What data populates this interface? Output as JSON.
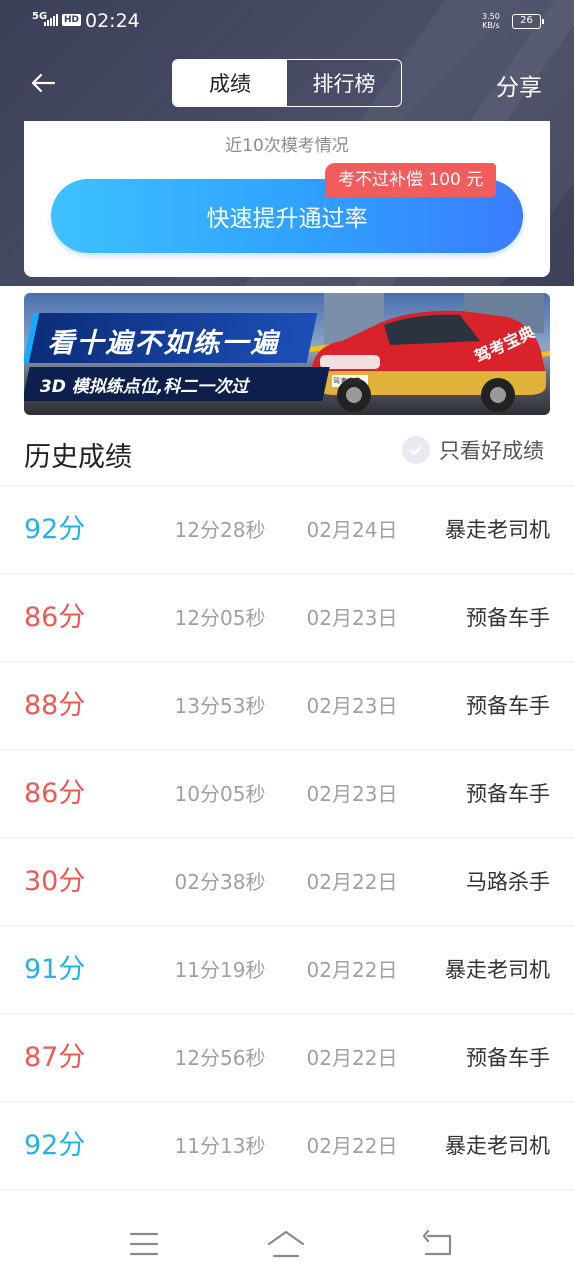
{
  "status_bar": {
    "network": "5G",
    "hd": "HD",
    "time": "02:24",
    "speed_value": "3.50",
    "speed_unit": "KB/s",
    "battery": "26"
  },
  "nav": {
    "back_icon": "arrow-left-icon",
    "tabs": [
      {
        "label": "成绩",
        "active": true
      },
      {
        "label": "排行榜",
        "active": false
      }
    ],
    "share_label": "分享"
  },
  "summary_card": {
    "subtitle": "近10次模考情况",
    "button_label": "快速提升通过率",
    "badge": "考不过补偿 100 元"
  },
  "banner": {
    "headline": "看十遍不如练一遍",
    "subline": "3D 模拟练点位,科二一次过",
    "car_text": "驾考宝典",
    "plate_text": "驾考宝典"
  },
  "history": {
    "title": "历史成绩",
    "filter_label": "只看好成绩",
    "filter_icon": "check-circle-icon",
    "rows": [
      {
        "score": "92分",
        "status": "good",
        "duration": "12分28秒",
        "date": "02月24日",
        "title": "暴走老司机"
      },
      {
        "score": "86分",
        "status": "bad",
        "duration": "12分05秒",
        "date": "02月23日",
        "title": "预备车手"
      },
      {
        "score": "88分",
        "status": "bad",
        "duration": "13分53秒",
        "date": "02月23日",
        "title": "预备车手"
      },
      {
        "score": "86分",
        "status": "bad",
        "duration": "10分05秒",
        "date": "02月23日",
        "title": "预备车手"
      },
      {
        "score": "30分",
        "status": "bad",
        "duration": "02分38秒",
        "date": "02月22日",
        "title": "马路杀手"
      },
      {
        "score": "91分",
        "status": "good",
        "duration": "11分19秒",
        "date": "02月22日",
        "title": "暴走老司机"
      },
      {
        "score": "87分",
        "status": "bad",
        "duration": "12分56秒",
        "date": "02月22日",
        "title": "预备车手"
      },
      {
        "score": "92分",
        "status": "good",
        "duration": "11分13秒",
        "date": "02月22日",
        "title": "暴走老司机"
      }
    ]
  },
  "bottom_nav": {
    "icons": [
      "menu-icon",
      "home-icon",
      "back-icon"
    ]
  },
  "colors": {
    "header_bg": "#3b3f57",
    "good_score": "#2ab0e8",
    "bad_score": "#ea5b55",
    "button_blue": "#2fa0ff",
    "badge_red": "#f35c5c"
  }
}
